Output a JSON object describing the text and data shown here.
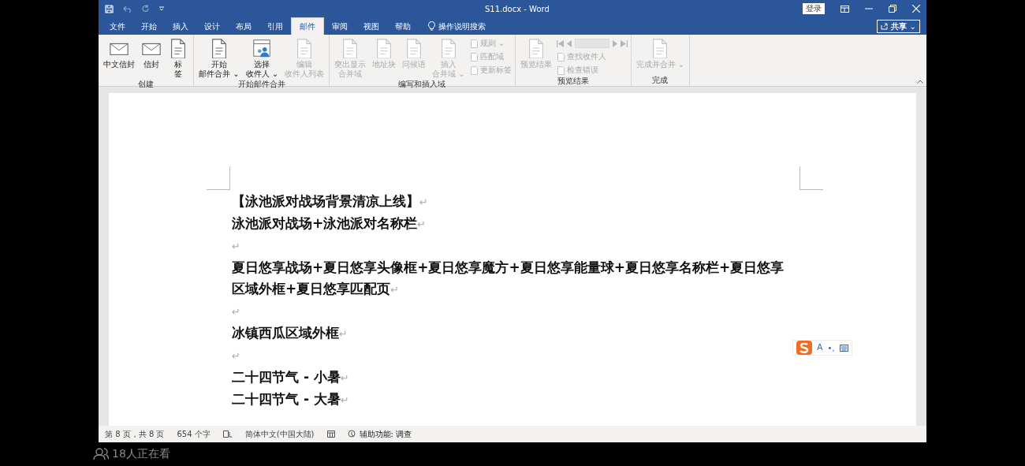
{
  "window": {
    "title": "S11.docx - Word",
    "sign_in": "登录",
    "share": "共享",
    "share_caret": "⌄"
  },
  "tabs": [
    {
      "label": "文件",
      "selected": false
    },
    {
      "label": "开始",
      "selected": false
    },
    {
      "label": "插入",
      "selected": false
    },
    {
      "label": "设计",
      "selected": false
    },
    {
      "label": "布局",
      "selected": false
    },
    {
      "label": "引用",
      "selected": false
    },
    {
      "label": "邮件",
      "selected": true
    },
    {
      "label": "审阅",
      "selected": false
    },
    {
      "label": "视图",
      "selected": false
    },
    {
      "label": "帮助",
      "selected": false
    }
  ],
  "tell_me": "操作说明搜索",
  "ribbon_groups": [
    {
      "label": "创建",
      "buttons": [
        {
          "kind": "large",
          "lines": [
            "中文信封"
          ],
          "disabled": false
        },
        {
          "kind": "large",
          "lines": [
            "信封"
          ],
          "disabled": false
        },
        {
          "kind": "large",
          "lines": [
            "标",
            "签"
          ],
          "disabled": false
        }
      ]
    },
    {
      "label": "开始邮件合并",
      "buttons": [
        {
          "kind": "large",
          "lines": [
            "开始",
            "邮件合并"
          ],
          "caret": "⌄",
          "disabled": false
        },
        {
          "kind": "large",
          "lines": [
            "选择",
            "收件人"
          ],
          "caret": "⌄",
          "disabled": false
        },
        {
          "kind": "large",
          "lines": [
            "编辑",
            "收件人列表"
          ],
          "disabled": true
        }
      ]
    },
    {
      "label": "编写和插入域",
      "buttons": [
        {
          "kind": "large",
          "lines": [
            "突出显示",
            "合并域"
          ],
          "disabled": true
        },
        {
          "kind": "large",
          "lines": [
            "地址块"
          ],
          "disabled": true
        },
        {
          "kind": "large",
          "lines": [
            "问候语"
          ],
          "disabled": true
        },
        {
          "kind": "large",
          "lines": [
            "插入",
            "合并域"
          ],
          "caret": "⌄",
          "disabled": true
        },
        {
          "kind": "small",
          "lines": [
            "规则"
          ],
          "caret": "⌄",
          "disabled": true
        },
        {
          "kind": "small",
          "lines": [
            "匹配域"
          ],
          "disabled": true
        },
        {
          "kind": "small",
          "lines": [
            "更新标签"
          ],
          "disabled": true
        }
      ]
    },
    {
      "label": "预览结果",
      "buttons": [
        {
          "kind": "large",
          "lines": [
            "预览结果"
          ],
          "disabled": true
        },
        {
          "kind": "nav",
          "disabled": true
        },
        {
          "kind": "small",
          "lines": [
            "查找收件人"
          ],
          "disabled": true
        },
        {
          "kind": "small",
          "lines": [
            "检查错误"
          ],
          "disabled": true
        }
      ]
    },
    {
      "label": "完成",
      "buttons": [
        {
          "kind": "large",
          "lines": [
            "完成并合并"
          ],
          "caret": "⌄",
          "disabled": true
        }
      ]
    }
  ],
  "paragraphs": [
    {
      "text": "【泳池派对战场背景清凉上线】",
      "mark": "↵"
    },
    {
      "text": "泳池派对战场+泳池派对名称栏",
      "mark": "↵"
    },
    {
      "mark": "↵"
    },
    {
      "text": "夏日悠享战场+夏日悠享头像框+夏日悠享魔方+夏日悠享能量球+夏日悠享名称栏+夏日悠享区域外框+夏日悠享匹配页",
      "mark": "↵"
    },
    {
      "mark": "↵"
    },
    {
      "text": "冰镇西瓜区域外框",
      "mark": "↵"
    },
    {
      "mark": "↵"
    },
    {
      "text": "二十四节气 - 小暑",
      "mark": "↵"
    },
    {
      "text": "二十四节气 - 大暑",
      "mark": "↵"
    }
  ],
  "ime": {
    "mode": "A",
    "punctuation": "•,"
  },
  "status_bar": {
    "page": "第 8 页，共 8 页",
    "words": "654 个字",
    "language": "简体中文(中国大陆)",
    "accessibility": "辅助功能: 调查"
  },
  "viewers": "18人正在看"
}
